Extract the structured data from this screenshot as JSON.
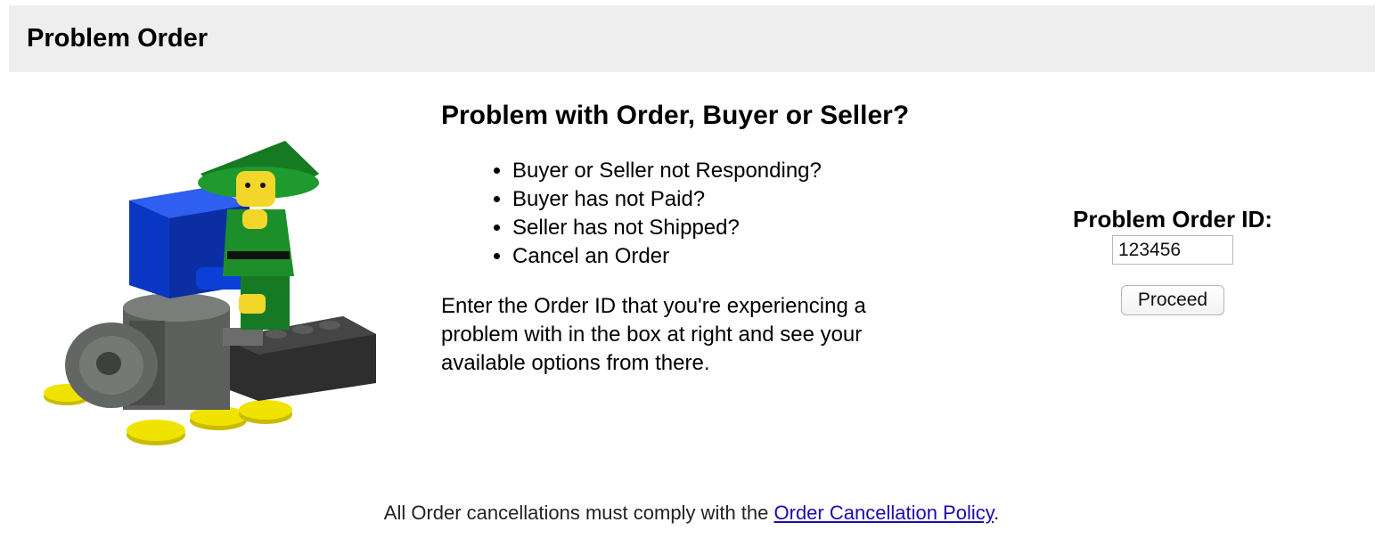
{
  "header": {
    "title": "Problem Order"
  },
  "illustration": {
    "icon": "lego-minifig-with-treasure-chest-and-gold-coins-icon"
  },
  "main": {
    "heading": "Problem with Order, Buyer or Seller?",
    "items": [
      "Buyer or Seller not Responding?",
      "Buyer has not Paid?",
      "Seller has not Shipped?",
      "Cancel an Order"
    ],
    "instructions": "Enter the Order ID that you're experiencing a problem with in the box at right and see your available options from there."
  },
  "order_form": {
    "label": "Problem Order ID:",
    "value": "123456",
    "button_label": "Proceed"
  },
  "footer": {
    "text_before": "All Order cancellations must comply with the ",
    "link_text": "Order Cancellation Policy",
    "text_after": "."
  },
  "colors": {
    "header_background": "#eeeeee",
    "link": "#1a0dab",
    "minifig_green": "#1f8f2c",
    "chest_blue": "#0c3fcf",
    "brick_dark": "#3a3a3a",
    "coin_yellow": "#f1e300"
  }
}
